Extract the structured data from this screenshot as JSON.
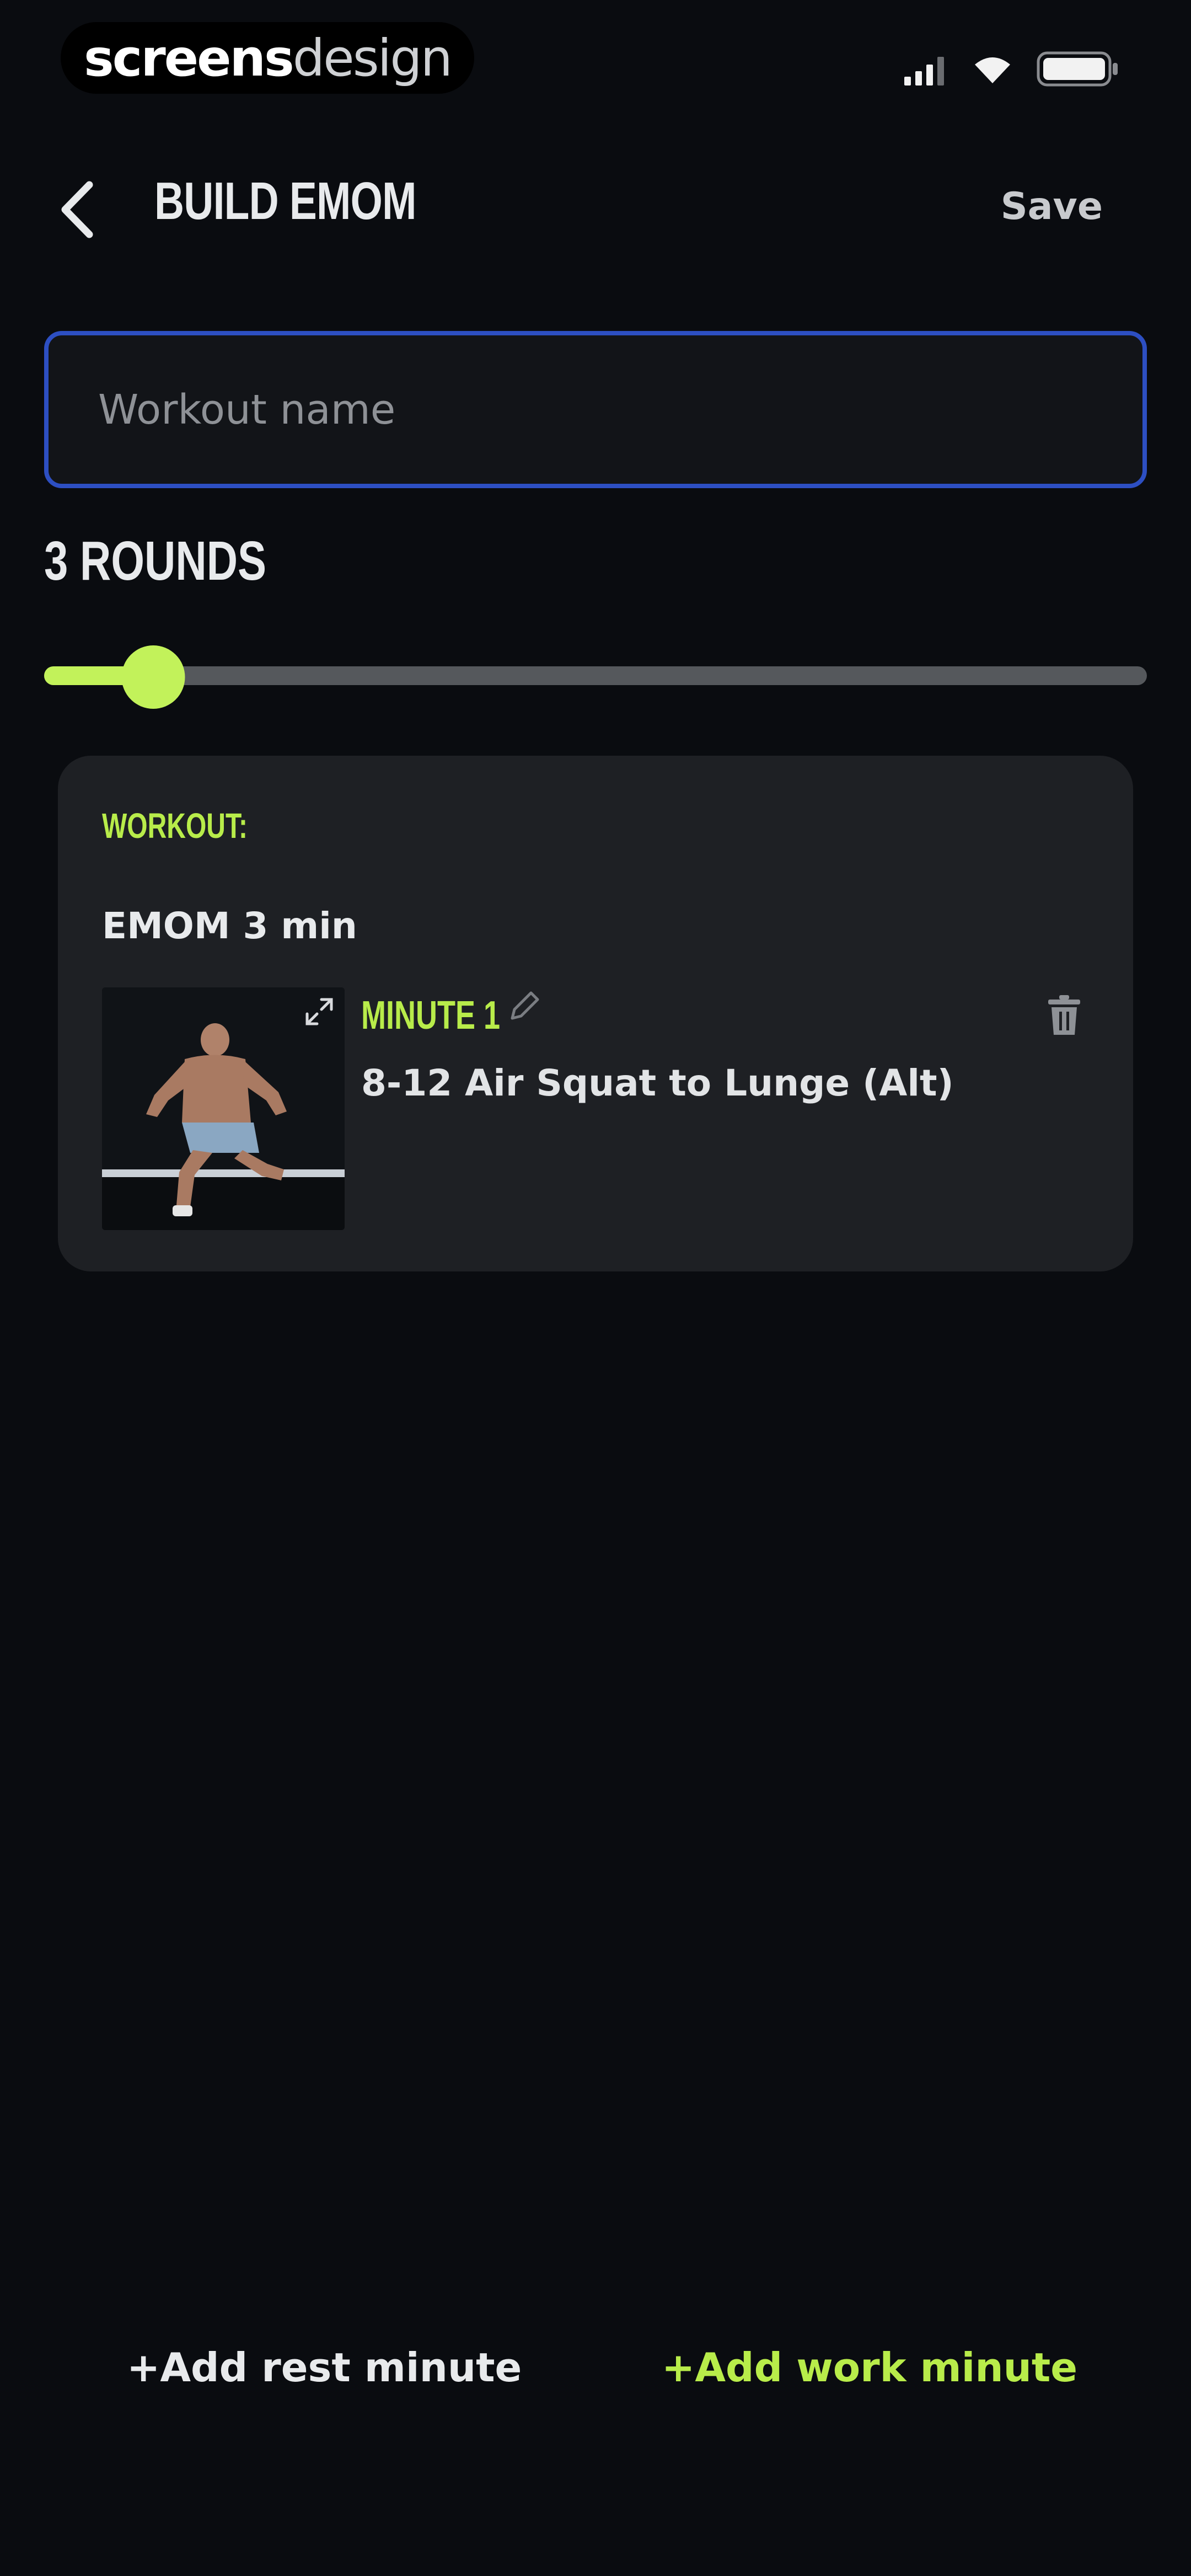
{
  "watermark": {
    "part1": "screens",
    "part2": "design"
  },
  "header": {
    "title": "BUILD EMOM",
    "save_label": "Save"
  },
  "workout_name": {
    "placeholder": "Workout name",
    "value": ""
  },
  "rounds": {
    "label": "3 ROUNDS",
    "value": 3,
    "min": 1,
    "max": 30
  },
  "workout_card": {
    "label": "WORKOUT:",
    "title": "EMOM 3 min",
    "items": [
      {
        "minute_label": "MINUTE 1",
        "exercise": "8-12 Air Squat to Lunge (Alt)"
      }
    ]
  },
  "actions": {
    "add_rest": "+Add rest minute",
    "add_work": "+Add work minute"
  },
  "colors": {
    "accent": "#c2f25a",
    "input_border": "#2d4fc2",
    "card_bg": "#1e2024",
    "background": "#0a0c10"
  },
  "icons": [
    "back-chevron-icon",
    "signal-icon",
    "wifi-icon",
    "battery-icon",
    "expand-icon",
    "pencil-icon",
    "trash-icon"
  ]
}
